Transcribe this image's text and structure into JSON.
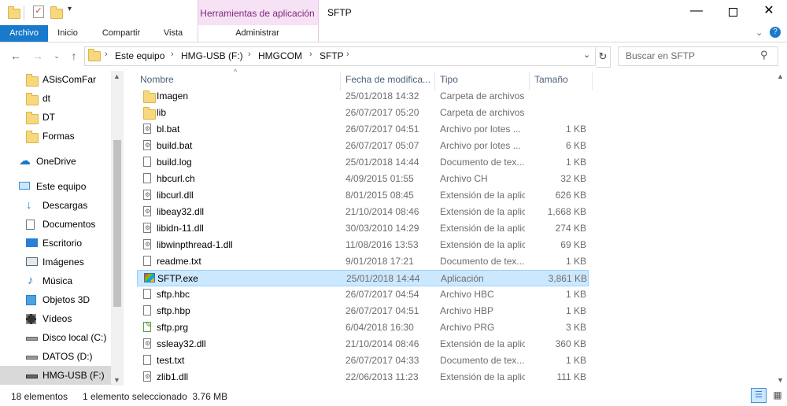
{
  "window": {
    "title": "SFTP",
    "contextual_tab_group": "Herramientas de aplicación",
    "min_icon": "minimize-icon",
    "max_icon": "maximize-icon",
    "close_icon": "close-icon"
  },
  "ribbon": {
    "tabs": [
      "Archivo",
      "Inicio",
      "Compartir",
      "Vista",
      "Administrar"
    ]
  },
  "address": {
    "crumbs": [
      "Este equipo",
      "HMG-USB (F:)",
      "HMGCOM",
      "SFTP"
    ],
    "search_placeholder": "Buscar en SFTP"
  },
  "nav_pane": {
    "items": [
      {
        "label": "ASisComFar",
        "icon": "folder-icon"
      },
      {
        "label": "dt",
        "icon": "folder-icon"
      },
      {
        "label": "DT",
        "icon": "folder-icon"
      },
      {
        "label": "Formas",
        "icon": "folder-icon"
      },
      {
        "label": "OneDrive",
        "icon": "cloud-icon"
      },
      {
        "label": "Este equipo",
        "icon": "computer-icon"
      },
      {
        "label": "Descargas",
        "icon": "download-icon"
      },
      {
        "label": "Documentos",
        "icon": "documents-icon"
      },
      {
        "label": "Escritorio",
        "icon": "desktop-icon"
      },
      {
        "label": "Imágenes",
        "icon": "pictures-icon"
      },
      {
        "label": "Música",
        "icon": "music-icon"
      },
      {
        "label": "Objetos 3D",
        "icon": "3d-objects-icon"
      },
      {
        "label": "Vídeos",
        "icon": "videos-icon"
      },
      {
        "label": "Disco local (C:)",
        "icon": "drive-icon"
      },
      {
        "label": "DATOS (D:)",
        "icon": "drive-icon"
      },
      {
        "label": "HMG-USB (F:)",
        "icon": "usb-drive-icon"
      }
    ]
  },
  "columns": {
    "name": "Nombre",
    "date": "Fecha de modifica...",
    "type": "Tipo",
    "size": "Tamaño"
  },
  "files": [
    {
      "name": "Imagen",
      "date": "25/01/2018 14:32",
      "type": "Carpeta de archivos",
      "size": "",
      "icon": "folder"
    },
    {
      "name": "lib",
      "date": "26/07/2017 05:20",
      "type": "Carpeta de archivos",
      "size": "",
      "icon": "folder"
    },
    {
      "name": "bl.bat",
      "date": "26/07/2017 04:51",
      "type": "Archivo por lotes ...",
      "size": "1 KB",
      "icon": "gear"
    },
    {
      "name": "build.bat",
      "date": "26/07/2017 05:07",
      "type": "Archivo por lotes ...",
      "size": "6 KB",
      "icon": "gear"
    },
    {
      "name": "build.log",
      "date": "25/01/2018 14:44",
      "type": "Documento de tex...",
      "size": "1 KB",
      "icon": "doc"
    },
    {
      "name": "hbcurl.ch",
      "date": "4/09/2015 01:55",
      "type": "Archivo CH",
      "size": "32 KB",
      "icon": "doc"
    },
    {
      "name": "libcurl.dll",
      "date": "8/01/2015 08:45",
      "type": "Extensión de la aplic...",
      "size": "626 KB",
      "icon": "gear"
    },
    {
      "name": "libeay32.dll",
      "date": "21/10/2014 08:46",
      "type": "Extensión de la aplic...",
      "size": "1,668 KB",
      "icon": "gear"
    },
    {
      "name": "libidn-11.dll",
      "date": "30/03/2010 14:29",
      "type": "Extensión de la aplic...",
      "size": "274 KB",
      "icon": "gear"
    },
    {
      "name": "libwinpthread-1.dll",
      "date": "11/08/2016 13:53",
      "type": "Extensión de la aplic...",
      "size": "69 KB",
      "icon": "gear"
    },
    {
      "name": "readme.txt",
      "date": "9/01/2018 17:21",
      "type": "Documento de tex...",
      "size": "1 KB",
      "icon": "doc"
    },
    {
      "name": "SFTP.exe",
      "date": "25/01/2018 14:44",
      "type": "Aplicación",
      "size": "3,861 KB",
      "icon": "exe"
    },
    {
      "name": "sftp.hbc",
      "date": "26/07/2017 04:54",
      "type": "Archivo HBC",
      "size": "1 KB",
      "icon": "doc"
    },
    {
      "name": "sftp.hbp",
      "date": "26/07/2017 04:51",
      "type": "Archivo HBP",
      "size": "1 KB",
      "icon": "doc"
    },
    {
      "name": "sftp.prg",
      "date": "6/04/2018 16:30",
      "type": "Archivo PRG",
      "size": "3 KB",
      "icon": "prg"
    },
    {
      "name": "ssleay32.dll",
      "date": "21/10/2014 08:46",
      "type": "Extensión de la aplic...",
      "size": "360 KB",
      "icon": "gear"
    },
    {
      "name": "test.txt",
      "date": "26/07/2017 04:33",
      "type": "Documento de tex...",
      "size": "1 KB",
      "icon": "doc"
    },
    {
      "name": "zlib1.dll",
      "date": "22/06/2013 11:23",
      "type": "Extensión de la aplic...",
      "size": "111 KB",
      "icon": "gear"
    }
  ],
  "status": {
    "count": "18 elementos",
    "selection": "1 elemento seleccionado  3.76 MB"
  }
}
